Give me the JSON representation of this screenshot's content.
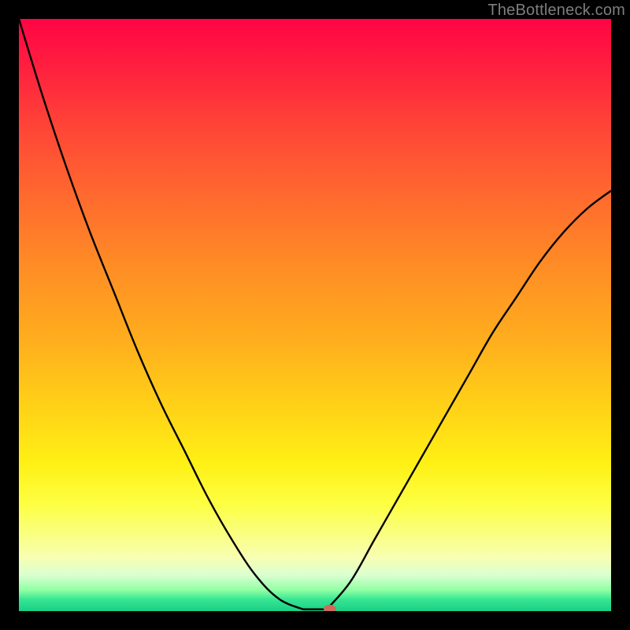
{
  "attribution": "TheBottleneck.com",
  "chart_data": {
    "type": "line",
    "title": "",
    "xlabel": "",
    "ylabel": "",
    "xlim": [
      0,
      100
    ],
    "ylim": [
      0,
      100
    ],
    "grid": false,
    "legend": false,
    "background_gradient": {
      "top": "#ff0444",
      "bottom": "#18cf84",
      "description": "Vertical rainbow gradient from red (top) through orange, yellow, to green (bottom)"
    },
    "series": [
      {
        "name": "bottleneck-curve",
        "description": "V-shaped curve that descends steeply from top-left, reaches a minimum near x≈48–52 at y≈0, then rises toward the right edge reaching about y≈71 at x=100",
        "curve_segments": {
          "left": {
            "x": [
              0,
              4,
              8,
              12,
              16,
              20,
              24,
              28,
              32,
              36,
              40,
              44,
              48
            ],
            "y": [
              100,
              87,
              75,
              64,
              54,
              44,
              35,
              27,
              19,
              12,
              6,
              2,
              0.3
            ]
          },
          "flat": {
            "x": [
              48,
              52
            ],
            "y": [
              0.3,
              0.3
            ]
          },
          "right": {
            "x": [
              52,
              56,
              60,
              64,
              68,
              72,
              76,
              80,
              84,
              88,
              92,
              96,
              100
            ],
            "y": [
              0.3,
              5,
              12,
              19,
              26,
              33,
              40,
              47,
              53,
              59,
              64,
              68,
              71
            ]
          }
        },
        "stroke": "#000000",
        "stroke_width": 2.4
      }
    ],
    "marker": {
      "name": "optimal-point",
      "x": 52.5,
      "y": 0,
      "color": "#d06a5a",
      "rx": 8,
      "ry": 5
    }
  },
  "colors": {
    "page_bg": "#000000",
    "attribution_text": "#7e7e7e"
  }
}
